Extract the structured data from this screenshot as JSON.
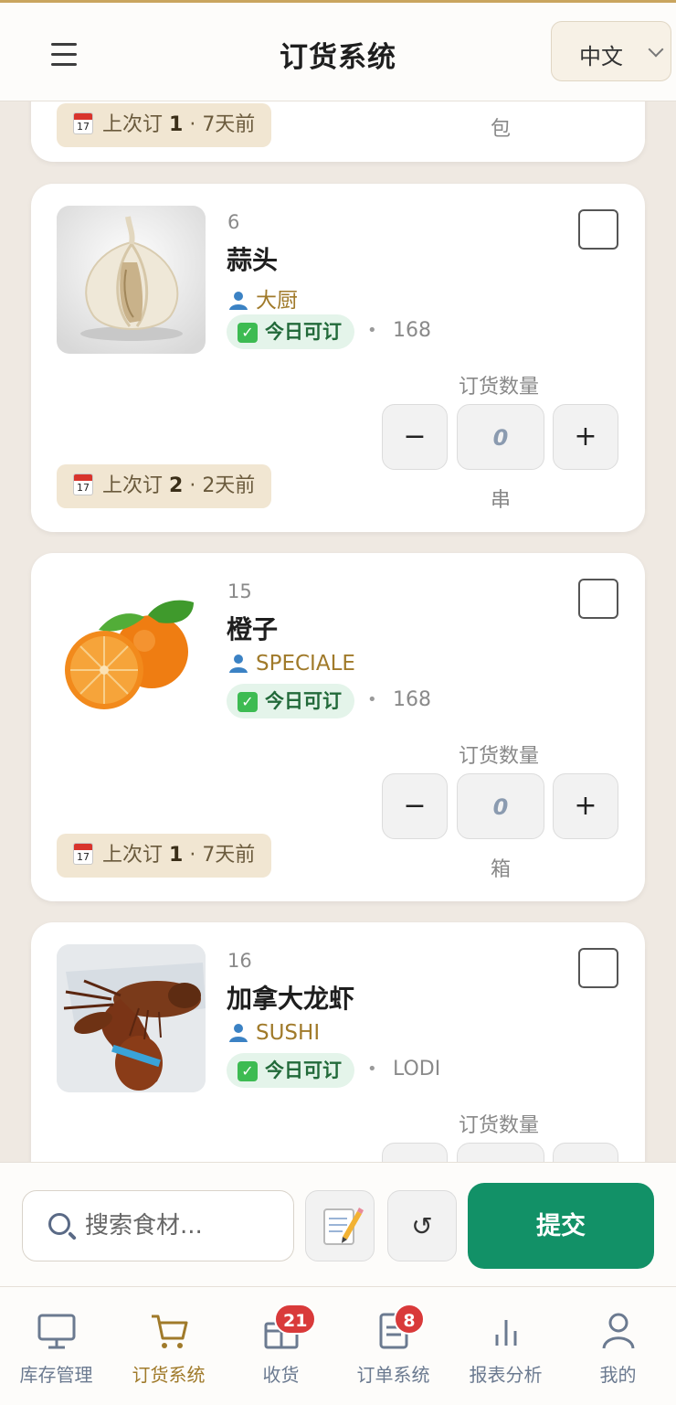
{
  "header": {
    "title": "订货系统",
    "language": "中文"
  },
  "partial_card": {
    "last_order_prefix": "上次订",
    "last_order_count": "1",
    "last_order_ago": "7天前",
    "unit": "包"
  },
  "items": [
    {
      "number": "6",
      "name": "蒜头",
      "role": "大厨",
      "availability": "今日可订",
      "code": "168",
      "quantity_label": "订货数量",
      "quantity": "0",
      "unit": "串",
      "last_order_prefix": "上次订",
      "last_order_count": "2",
      "last_order_ago": "2天前",
      "minus_label": "−",
      "plus_label": "+"
    },
    {
      "number": "15",
      "name": "橙子",
      "role": "SPECIALE",
      "availability": "今日可订",
      "code": "168",
      "quantity_label": "订货数量",
      "quantity": "0",
      "unit": "箱",
      "last_order_prefix": "上次订",
      "last_order_count": "1",
      "last_order_ago": "7天前",
      "minus_label": "−",
      "plus_label": "+"
    },
    {
      "number": "16",
      "name": "加拿大龙虾",
      "role": "SUSHI",
      "availability": "今日可订",
      "code": "LODI",
      "quantity_label": "订货数量"
    }
  ],
  "bottom_bar": {
    "search_placeholder": "搜索食材...",
    "reset_symbol": "↺",
    "submit_label": "提交"
  },
  "nav": [
    {
      "label": "库存管理",
      "icon": "monitor-icon"
    },
    {
      "label": "订货系统",
      "icon": "cart-icon",
      "active": true
    },
    {
      "label": "收货",
      "icon": "package-icon",
      "badge": "21"
    },
    {
      "label": "订单系统",
      "icon": "document-icon",
      "badge": "8"
    },
    {
      "label": "报表分析",
      "icon": "bar-chart-icon"
    },
    {
      "label": "我的",
      "icon": "user-icon"
    }
  ],
  "colors": {
    "accent": "#a07a2a",
    "primary": "#129167",
    "badge": "#d93a3a"
  }
}
